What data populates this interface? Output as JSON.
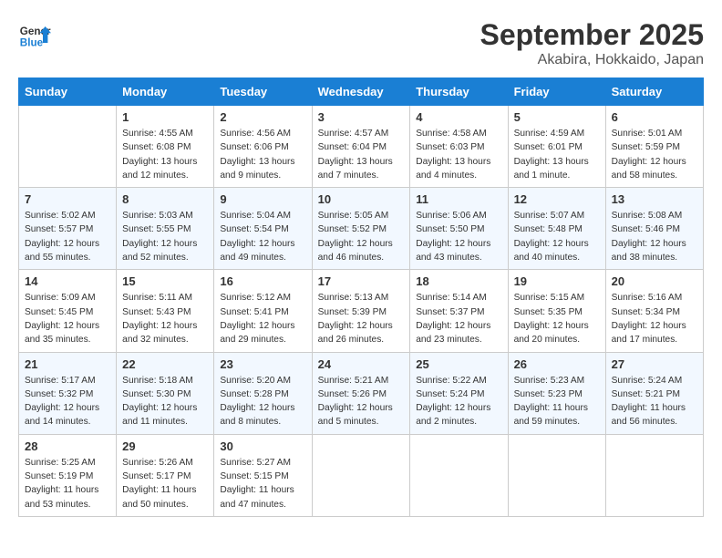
{
  "header": {
    "logo_general": "General",
    "logo_blue": "Blue",
    "month": "September 2025",
    "location": "Akabira, Hokkaido, Japan"
  },
  "weekdays": [
    "Sunday",
    "Monday",
    "Tuesday",
    "Wednesday",
    "Thursday",
    "Friday",
    "Saturday"
  ],
  "weeks": [
    [
      {
        "day": "",
        "empty": true
      },
      {
        "day": "1",
        "sunrise": "4:55 AM",
        "sunset": "6:08 PM",
        "daylight": "13 hours and 12 minutes."
      },
      {
        "day": "2",
        "sunrise": "4:56 AM",
        "sunset": "6:06 PM",
        "daylight": "13 hours and 9 minutes."
      },
      {
        "day": "3",
        "sunrise": "4:57 AM",
        "sunset": "6:04 PM",
        "daylight": "13 hours and 7 minutes."
      },
      {
        "day": "4",
        "sunrise": "4:58 AM",
        "sunset": "6:03 PM",
        "daylight": "13 hours and 4 minutes."
      },
      {
        "day": "5",
        "sunrise": "4:59 AM",
        "sunset": "6:01 PM",
        "daylight": "13 hours and 1 minute."
      },
      {
        "day": "6",
        "sunrise": "5:01 AM",
        "sunset": "5:59 PM",
        "daylight": "12 hours and 58 minutes."
      }
    ],
    [
      {
        "day": "7",
        "sunrise": "5:02 AM",
        "sunset": "5:57 PM",
        "daylight": "12 hours and 55 minutes."
      },
      {
        "day": "8",
        "sunrise": "5:03 AM",
        "sunset": "5:55 PM",
        "daylight": "12 hours and 52 minutes."
      },
      {
        "day": "9",
        "sunrise": "5:04 AM",
        "sunset": "5:54 PM",
        "daylight": "12 hours and 49 minutes."
      },
      {
        "day": "10",
        "sunrise": "5:05 AM",
        "sunset": "5:52 PM",
        "daylight": "12 hours and 46 minutes."
      },
      {
        "day": "11",
        "sunrise": "5:06 AM",
        "sunset": "5:50 PM",
        "daylight": "12 hours and 43 minutes."
      },
      {
        "day": "12",
        "sunrise": "5:07 AM",
        "sunset": "5:48 PM",
        "daylight": "12 hours and 40 minutes."
      },
      {
        "day": "13",
        "sunrise": "5:08 AM",
        "sunset": "5:46 PM",
        "daylight": "12 hours and 38 minutes."
      }
    ],
    [
      {
        "day": "14",
        "sunrise": "5:09 AM",
        "sunset": "5:45 PM",
        "daylight": "12 hours and 35 minutes."
      },
      {
        "day": "15",
        "sunrise": "5:11 AM",
        "sunset": "5:43 PM",
        "daylight": "12 hours and 32 minutes."
      },
      {
        "day": "16",
        "sunrise": "5:12 AM",
        "sunset": "5:41 PM",
        "daylight": "12 hours and 29 minutes."
      },
      {
        "day": "17",
        "sunrise": "5:13 AM",
        "sunset": "5:39 PM",
        "daylight": "12 hours and 26 minutes."
      },
      {
        "day": "18",
        "sunrise": "5:14 AM",
        "sunset": "5:37 PM",
        "daylight": "12 hours and 23 minutes."
      },
      {
        "day": "19",
        "sunrise": "5:15 AM",
        "sunset": "5:35 PM",
        "daylight": "12 hours and 20 minutes."
      },
      {
        "day": "20",
        "sunrise": "5:16 AM",
        "sunset": "5:34 PM",
        "daylight": "12 hours and 17 minutes."
      }
    ],
    [
      {
        "day": "21",
        "sunrise": "5:17 AM",
        "sunset": "5:32 PM",
        "daylight": "12 hours and 14 minutes."
      },
      {
        "day": "22",
        "sunrise": "5:18 AM",
        "sunset": "5:30 PM",
        "daylight": "12 hours and 11 minutes."
      },
      {
        "day": "23",
        "sunrise": "5:20 AM",
        "sunset": "5:28 PM",
        "daylight": "12 hours and 8 minutes."
      },
      {
        "day": "24",
        "sunrise": "5:21 AM",
        "sunset": "5:26 PM",
        "daylight": "12 hours and 5 minutes."
      },
      {
        "day": "25",
        "sunrise": "5:22 AM",
        "sunset": "5:24 PM",
        "daylight": "12 hours and 2 minutes."
      },
      {
        "day": "26",
        "sunrise": "5:23 AM",
        "sunset": "5:23 PM",
        "daylight": "11 hours and 59 minutes."
      },
      {
        "day": "27",
        "sunrise": "5:24 AM",
        "sunset": "5:21 PM",
        "daylight": "11 hours and 56 minutes."
      }
    ],
    [
      {
        "day": "28",
        "sunrise": "5:25 AM",
        "sunset": "5:19 PM",
        "daylight": "11 hours and 53 minutes."
      },
      {
        "day": "29",
        "sunrise": "5:26 AM",
        "sunset": "5:17 PM",
        "daylight": "11 hours and 50 minutes."
      },
      {
        "day": "30",
        "sunrise": "5:27 AM",
        "sunset": "5:15 PM",
        "daylight": "11 hours and 47 minutes."
      },
      {
        "day": "",
        "empty": true
      },
      {
        "day": "",
        "empty": true
      },
      {
        "day": "",
        "empty": true
      },
      {
        "day": "",
        "empty": true
      }
    ]
  ]
}
